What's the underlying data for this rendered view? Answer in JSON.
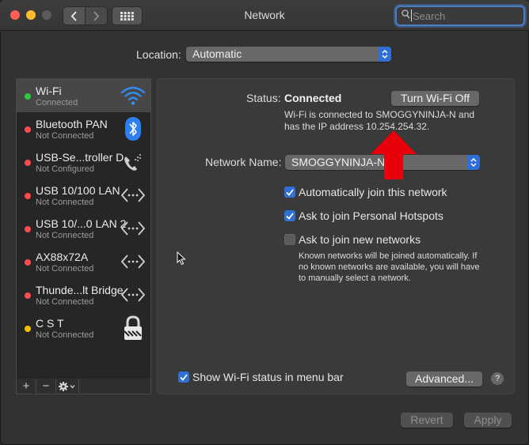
{
  "window": {
    "title": "Network"
  },
  "search": {
    "placeholder": "Search"
  },
  "location": {
    "label": "Location:",
    "value": "Automatic"
  },
  "services": [
    {
      "name": "Wi-Fi",
      "status": "Connected",
      "dot": "#2ec840",
      "icon": "wifi-icon",
      "selected": true
    },
    {
      "name": "Bluetooth PAN",
      "status": "Not Connected",
      "dot": "#fe4c4c",
      "icon": "bluetooth-icon"
    },
    {
      "name": "USB-Se...troller D",
      "status": "Not Configured",
      "dot": "#fe4c4c",
      "icon": "phone-icon"
    },
    {
      "name": "USB 10/100 LAN",
      "status": "Not Connected",
      "dot": "#fe4c4c",
      "icon": "ethernet-icon"
    },
    {
      "name": "USB 10/...0 LAN 2",
      "status": "Not Connected",
      "dot": "#fe4c4c",
      "icon": "ethernet-icon"
    },
    {
      "name": "AX88x72A",
      "status": "Not Connected",
      "dot": "#fe4c4c",
      "icon": "ethernet-icon"
    },
    {
      "name": "Thunde...lt Bridge",
      "status": "Not Connected",
      "dot": "#fe4c4c",
      "icon": "ethernet-icon"
    },
    {
      "name": "C S T",
      "status": "Not Connected",
      "dot": "#f5c000",
      "icon": "lock-icon"
    }
  ],
  "sidebar_toolbar": {
    "add": "+",
    "remove": "−"
  },
  "status": {
    "label": "Status:",
    "value": "Connected",
    "toggle_button": "Turn Wi-Fi Off",
    "description": "Wi-Fi is connected to SMOGGYNINJA-N and has the IP address 10.254.254.32."
  },
  "network": {
    "label": "Network Name:",
    "value": "SMOGGYNINJA-N"
  },
  "options": [
    {
      "label": "Automatically join this network",
      "checked": true
    },
    {
      "label": "Ask to join Personal Hotspots",
      "checked": true
    },
    {
      "label": "Ask to join new networks",
      "checked": false
    }
  ],
  "options_note": "Known networks will be joined automatically. If no known networks are available, you will have to manually select a network.",
  "show_status": {
    "label": "Show Wi-Fi status in menu bar",
    "checked": true
  },
  "buttons": {
    "advanced": "Advanced...",
    "help": "?",
    "revert": "Revert",
    "apply": "Apply"
  },
  "colors": {
    "accent": "#2f6fd6",
    "annotation_arrow": "#e8000b"
  }
}
